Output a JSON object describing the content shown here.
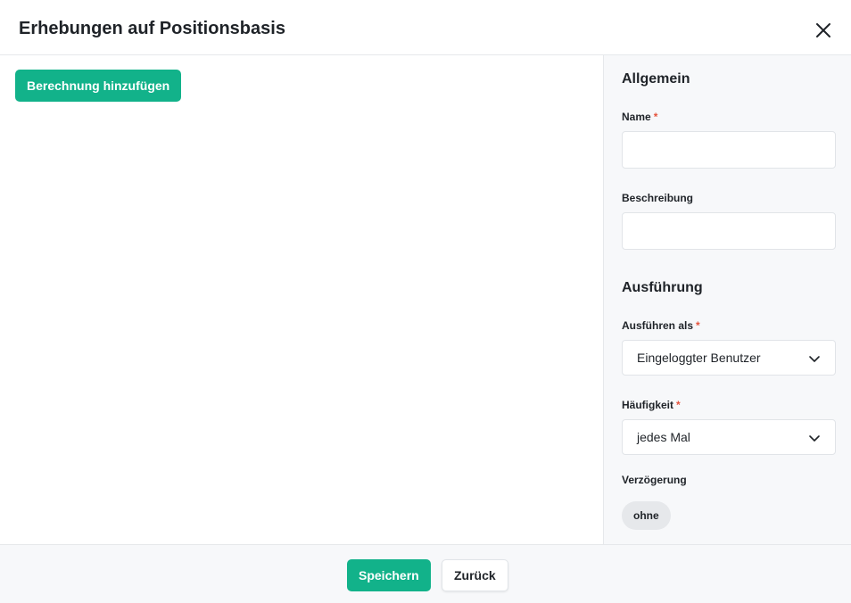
{
  "dialog": {
    "title": "Erhebungen auf Positionsbasis",
    "close_icon": "close-icon"
  },
  "main": {
    "add_calculation_label": "Berechnung hinzufügen"
  },
  "sidebar": {
    "general": {
      "title": "Allgemein",
      "name_label": "Name",
      "name_value": "",
      "description_label": "Beschreibung",
      "description_value": ""
    },
    "execution": {
      "title": "Ausführung",
      "run_as_label": "Ausführen als",
      "run_as_value": "Eingeloggter Benutzer",
      "frequency_label": "Häufigkeit",
      "frequency_value": "jedes Mal",
      "delay_label": "Verzögerung",
      "delay_value": "ohne"
    },
    "required_marker": "*"
  },
  "footer": {
    "save_label": "Speichern",
    "back_label": "Zurück"
  },
  "colors": {
    "primary": "#12b28a",
    "required": "#e5533d"
  }
}
